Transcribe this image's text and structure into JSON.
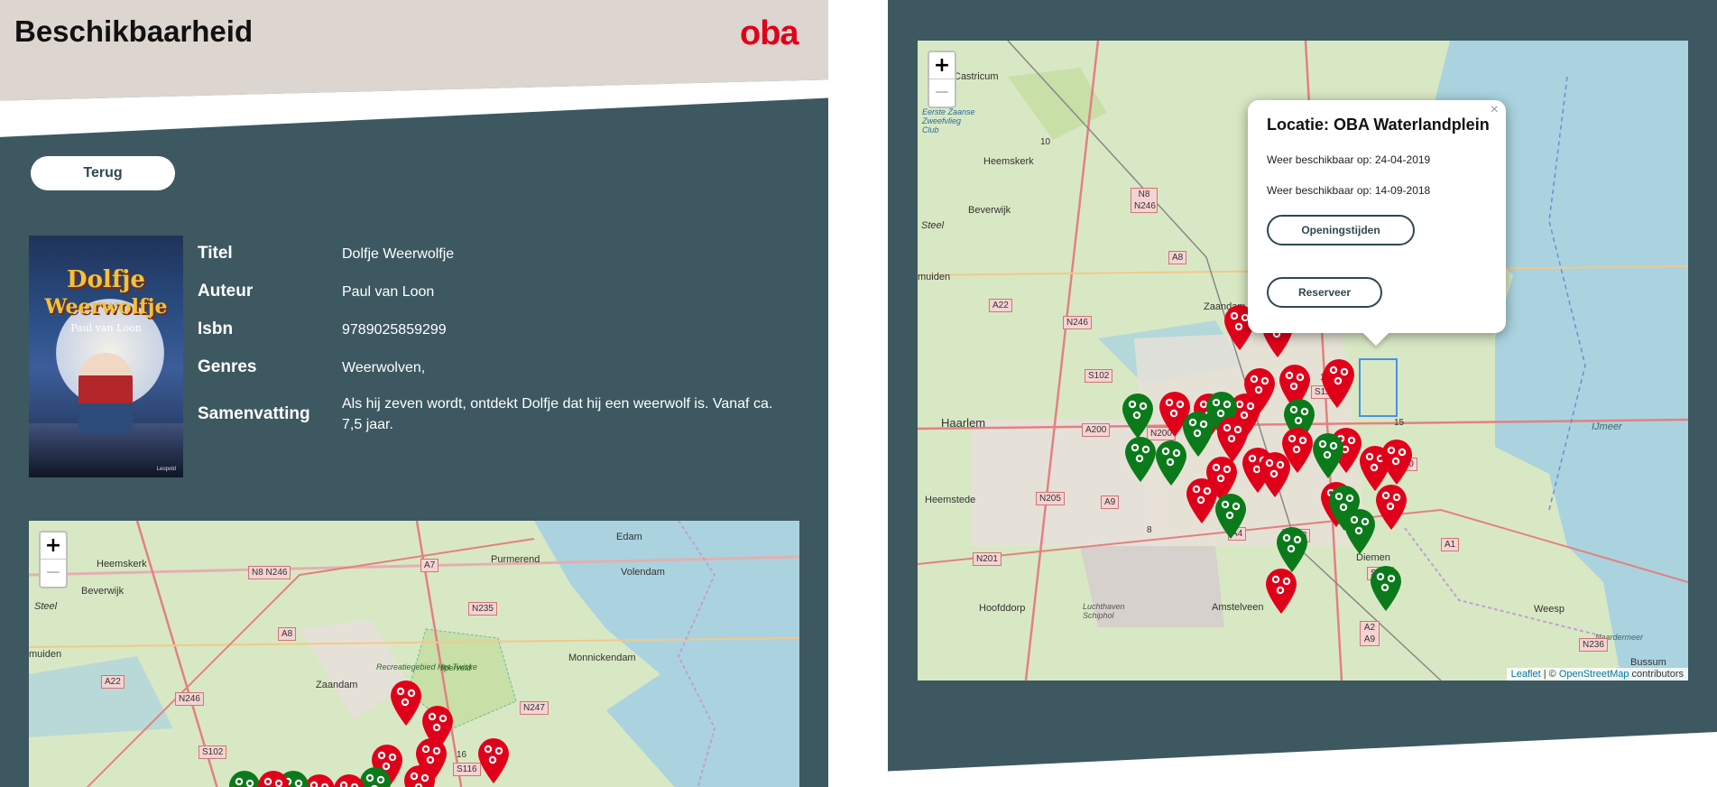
{
  "header": {
    "title": "Beschikbaarheid",
    "logo_text": "oba"
  },
  "back_button": {
    "label": "Terug"
  },
  "book": {
    "cover": {
      "title_line1": "Dolfje",
      "title_line2": "Weerwolfje",
      "author_line": "Paul van Loon",
      "publisher": "Leopold"
    },
    "fields": [
      {
        "label": "Titel",
        "value": "Dolfje Weerwolfje"
      },
      {
        "label": "Auteur",
        "value": "Paul van Loon"
      },
      {
        "label": "Isbn",
        "value": "9789025859299"
      },
      {
        "label": "Genres",
        "value": "Weerwolven,"
      },
      {
        "label": "Samenvatting",
        "value": "Als hij zeven wordt, ontdekt Dolfje dat hij een weerwolf is. Vanaf ca. 7,5 jaar."
      }
    ]
  },
  "map_small": {
    "zoom_in": "+",
    "zoom_out": "−",
    "place_labels": [
      "Heemskerk",
      "Beverwijk",
      "Purmerend",
      "Edam",
      "Volendam",
      "Monnickendam",
      "Zaandam",
      "Recreatiegebied Het Twiske",
      "Ilperveld",
      "muiden",
      "Steel"
    ],
    "road_labels": [
      "N8 N246",
      "A7",
      "N235",
      "A8",
      "A22",
      "N246",
      "N247",
      "S102",
      "S116",
      "16"
    ]
  },
  "map_large": {
    "zoom_in": "+",
    "zoom_out": "−",
    "place_labels": [
      "Castricum",
      "Eerste Zaanse Zweefvlieg Club",
      "Heemskerk",
      "Beverwijk",
      "Steel",
      "muiden",
      "Zaandam",
      "Haarlem",
      "Heemstede",
      "Hoofddorp",
      "Luchthaven Schiphol",
      "Amstelveen",
      "Diemen",
      "Weesp",
      "IJmeer",
      "Naardermeer",
      "Bussum"
    ],
    "road_labels": [
      "N8 N246",
      "A8",
      "A22",
      "N246",
      "S102",
      "A200",
      "N200",
      "N205",
      "A9",
      "A4",
      "S108",
      "N201",
      "S116",
      "A10",
      "A1",
      "A2 A9",
      "N236",
      "S111",
      "16",
      "15",
      "10",
      "8"
    ],
    "attribution": {
      "leaflet": "Leaflet",
      "separator": " | © ",
      "osm": "OpenStreetMap",
      "suffix": " contributors"
    }
  },
  "popup": {
    "close": "×",
    "title": "Locatie: OBA Waterlandplein",
    "lines": [
      "Weer beschikbaar op: 24-04-2019",
      "Weer beschikbaar op: 14-09-2018"
    ],
    "hours_button": "Openingstijden",
    "reserve_button": "Reserveer"
  },
  "colors": {
    "panel": "#3d5861",
    "header": "#dcd5d0",
    "marker_red": "#e1001a",
    "marker_green": "#0b7a1a",
    "brand": "#e1001a"
  }
}
